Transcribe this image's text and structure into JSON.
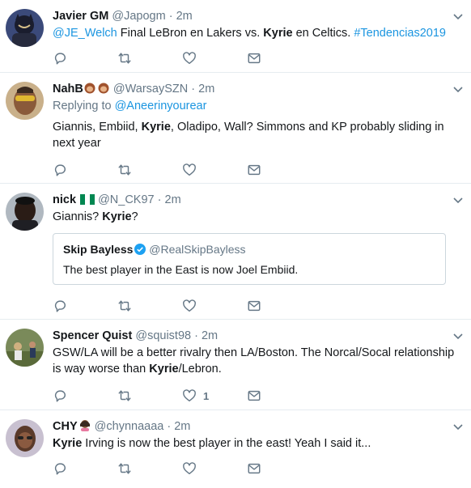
{
  "tweets": [
    {
      "name": "Javier GM",
      "handle": "@Japogm",
      "time": "2m",
      "dot": "·",
      "text_mention": "@JE_Welch",
      "text_before": " Final LeBron en Lakers vs. ",
      "text_bold": "Kyrie",
      "text_after": " en Celtics. ",
      "text_hashtag": "#Tendencias2019"
    },
    {
      "name": "NahB",
      "handle": "@WarsaySZN",
      "time": "2m",
      "dot": "·",
      "reply_prefix": "Replying to ",
      "reply_to": "@Aneerinyourear",
      "text_before": "Giannis, Embiid, ",
      "text_bold": "Kyrie",
      "text_after": ", Oladipo, Wall? Simmons and KP probably sliding in next year"
    },
    {
      "name": "nick",
      "handle": "@N_CK97",
      "time": "2m",
      "dot": "·",
      "text_before": "Giannis? ",
      "text_bold": "Kyrie",
      "text_after": "?",
      "quote": {
        "name": "Skip Bayless",
        "handle": "@RealSkipBayless",
        "text": "The best player in the East is now Joel Embiid."
      }
    },
    {
      "name": "Spencer Quist",
      "handle": "@squist98",
      "time": "2m",
      "dot": "·",
      "text_before": "GSW/LA will be a better rivalry then LA/Boston. The Norcal/Socal relationship is way worse than ",
      "text_bold": "Kyrie",
      "text_after": "/Lebron.",
      "like_count": "1"
    },
    {
      "name": "CHY",
      "handle": "@chynnaaaa",
      "time": "2m",
      "dot": "·",
      "text_bold": "Kyrie",
      "text_after": " Irving is now the best player in the east! Yeah I said it..."
    }
  ],
  "icons": {
    "reply": "reply-icon",
    "retweet": "retweet-icon",
    "like": "heart-icon",
    "dm": "envelope-icon",
    "more": "chevron-down-icon"
  },
  "colors": {
    "link": "#1b95e0",
    "muted": "#657786",
    "border": "#e6ecf0",
    "icon": "#657786"
  }
}
